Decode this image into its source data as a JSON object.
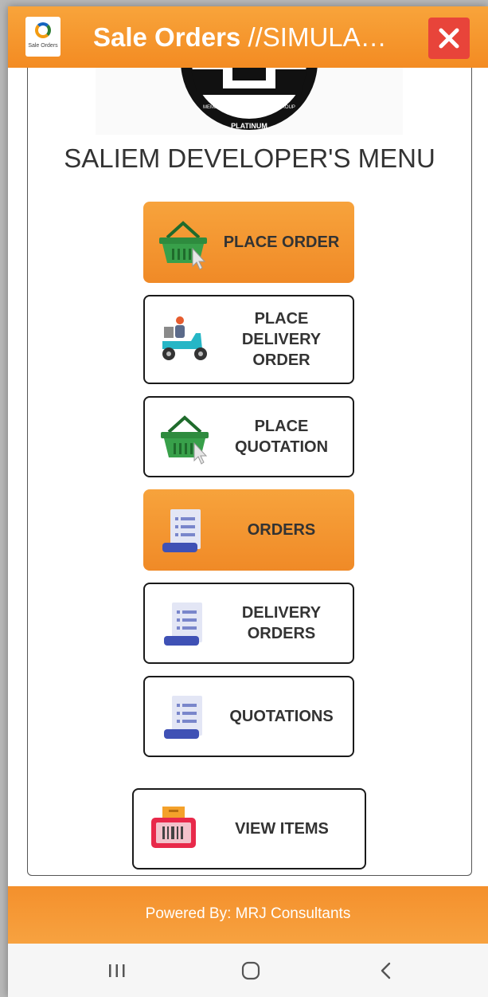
{
  "titlebar": {
    "app_icon_text": "Sale Orders",
    "title_bold": "Sale Orders",
    "title_rest": " //SIMULA…",
    "close_icon": "close-icon"
  },
  "logo": {
    "line1": "MEMBER OF THE BLUE BOTTLE GROUP",
    "line2": "PLATINUM"
  },
  "menu": {
    "heading": "SALIEM DEVELOPER'S MENU",
    "items": [
      {
        "label": "PLACE ORDER",
        "icon": "basket-icon",
        "highlighted": true
      },
      {
        "label": "PLACE DELIVERY ORDER",
        "icon": "scooter-delivery-icon",
        "highlighted": false
      },
      {
        "label": "PLACE QUOTATION",
        "icon": "basket-icon",
        "highlighted": false
      },
      {
        "label": "ORDERS",
        "icon": "receipt-icon",
        "highlighted": true
      },
      {
        "label": "DELIVERY ORDERS",
        "icon": "receipt-icon",
        "highlighted": false
      },
      {
        "label": "QUOTATIONS",
        "icon": "receipt-icon",
        "highlighted": false
      },
      {
        "label": "VIEW ITEMS",
        "icon": "barcode-box-icon",
        "highlighted": false
      }
    ]
  },
  "footer": {
    "text": "Powered By: MRJ Consultants"
  },
  "navbar": {
    "icons": [
      "recent-apps-icon",
      "home-icon",
      "back-icon"
    ]
  },
  "colors": {
    "accent": "#F39A2E",
    "close": "#E8443A",
    "basket": "#2E8B3E",
    "receipt": "#3F51B5"
  }
}
